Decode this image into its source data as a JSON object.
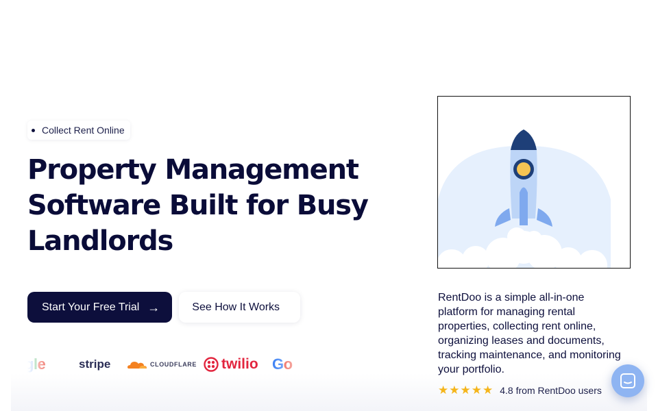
{
  "hero": {
    "eyebrow": "Collect Rent Online",
    "headline_lines": [
      "Property Management",
      "Software Built for Busy",
      "Landlords"
    ]
  },
  "cta": {
    "primary_label": "Start Your Free Trial",
    "secondary_label": "See How It Works"
  },
  "logos": {
    "items": [
      "oogle",
      "stripe",
      "CLOUDFLARE",
      "twilio",
      "Go"
    ]
  },
  "description": "RentDoo is a simple all-in-one platform for managing rental properties, collecting rent online, organizing leases and documents, tracking maintenance, and monitoring your portfolio.",
  "rating": {
    "score": 4.8,
    "stars": 5,
    "text": "4.8 from RentDoo users"
  },
  "icons": {
    "arrow": "arrow-right-icon",
    "star": "star-icon",
    "chat": "chat-icon",
    "rocket": "rocket-illustration"
  },
  "colors": {
    "brand_navy": "#0d0f3c",
    "star_yellow": "#f5b51b",
    "rocket_blue": "#7fa9ee",
    "chat_blue": "#8eb4f2"
  }
}
